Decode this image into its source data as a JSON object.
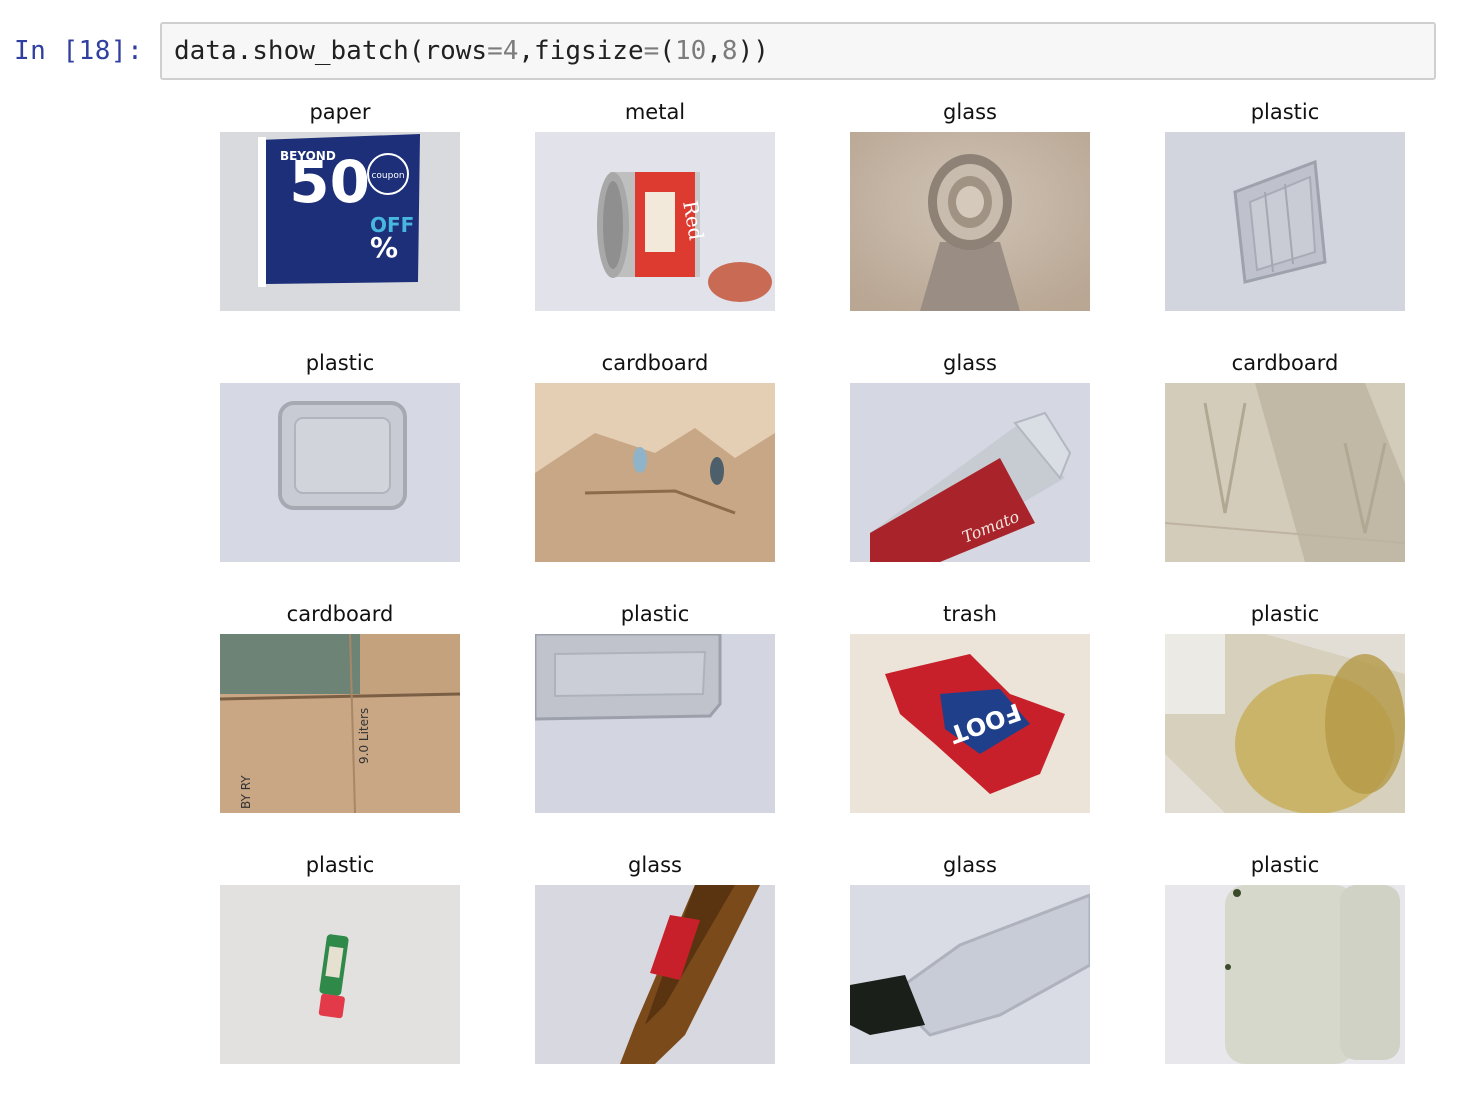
{
  "cell": {
    "prompt": "In [18]:",
    "code": {
      "p1": "data.show_batch(rows",
      "eq1": "=",
      "n1": "4",
      "p2": ",figsize",
      "eq2": "=",
      "p3": "(",
      "n2": "10",
      "p4": ",",
      "n3": "8",
      "p5": "))"
    }
  },
  "batch": {
    "titles": [
      "paper",
      "metal",
      "glass",
      "plastic",
      "plastic",
      "cardboard",
      "glass",
      "cardboard",
      "cardboard",
      "plastic",
      "trash",
      "plastic",
      "plastic",
      "glass",
      "glass",
      "plastic"
    ],
    "image_texts": {
      "paper_big": "50",
      "paper_off": "OFF",
      "paper_pct": "%",
      "paper_beyond": "BEYOND",
      "paper_coupon": "coupon",
      "metal_label": "Red",
      "glass_jar_label": "Tomato",
      "cardboard_liters": "9.0 Liters",
      "cardboard_bottom": "BY RY",
      "trash_brand": "FOOT"
    }
  }
}
